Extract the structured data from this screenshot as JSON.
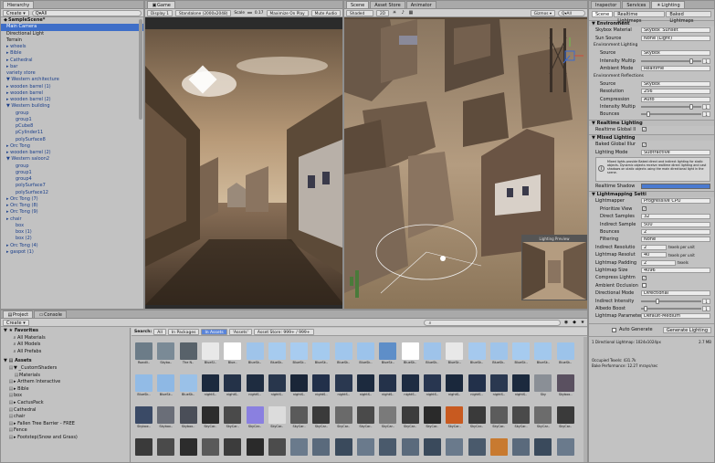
{
  "hierarchy": {
    "tab": "Hierarchy",
    "create": "Create ▾",
    "search": "Q▾All",
    "scene": "SampleScene*",
    "items": [
      {
        "t": "Main Camera",
        "sel": true
      },
      {
        "t": "Directional Light",
        "dk": true
      },
      {
        "t": "Terrain",
        "dk": true
      },
      {
        "t": "▸ wheels"
      },
      {
        "t": "▸ Bible"
      },
      {
        "t": "▸ Cathedral"
      },
      {
        "t": "▸ bar"
      },
      {
        "t": "variety store"
      },
      {
        "t": "▼ Western architecture"
      },
      {
        "t": "▸ wooden barrel (1)"
      },
      {
        "t": "▸ wooden barrel"
      },
      {
        "t": "▸ wooden barrel (2)"
      },
      {
        "t": "▼ Western building"
      },
      {
        "t": "group"
      },
      {
        "t": "group1"
      },
      {
        "t": "pCube8"
      },
      {
        "t": "pCylinder11"
      },
      {
        "t": "polySurface8"
      },
      {
        "t": "▸ Orc Tong"
      },
      {
        "t": "▸ wooden barrel (2)"
      },
      {
        "t": "▼ Western saloon2"
      },
      {
        "t": "group"
      },
      {
        "t": "group1"
      },
      {
        "t": "group4"
      },
      {
        "t": "polySurface7"
      },
      {
        "t": "polySurface12"
      },
      {
        "t": "▸ Orc Tong (7)"
      },
      {
        "t": "▸ Orc Tong (8)"
      },
      {
        "t": "▸ Orc Tong (9)"
      },
      {
        "t": "▸ chair"
      },
      {
        "t": "box"
      },
      {
        "t": "box (1)"
      },
      {
        "t": "box (2)"
      },
      {
        "t": "▸ Orc Tong (4)"
      },
      {
        "t": "▸ gaspot (1)"
      }
    ]
  },
  "game": {
    "tab": "Game",
    "display": "Display 1",
    "resolution": "Standalone (2000x2048)",
    "scale_label": "Scale",
    "scale_value": "0.17",
    "maximize": "Maximize On Play",
    "mute": "Mute Audio"
  },
  "scene": {
    "tabs": [
      "Scene",
      "Asset Store",
      "Animator"
    ],
    "shading": "Shaded",
    "mode2d": "2D",
    "gizmos": "Gizmos ▾",
    "search": "Q▾All",
    "preview_label": "Lighting Preview"
  },
  "inspector": {
    "tabs": [
      "Inspector",
      "Services",
      "Lighting"
    ],
    "subtabs": [
      "Scene",
      "Realtime Lightmaps",
      "Baked Lightmaps"
    ],
    "environment": {
      "header": "Environment",
      "skybox_label": "Skybox Material",
      "skybox_value": "Skybox_Sunset",
      "sun_label": "Sun Source",
      "sun_value": "None (Light)",
      "lighting_header": "Environment Lighting",
      "source_label": "Source",
      "source_value": "Skybox",
      "intensity_label": "Intensity Multip",
      "intensity_value": "1",
      "intensity_level": 0.85,
      "ambient_label": "Ambient Mode",
      "ambient_value": "Realtime",
      "reflections_header": "Environment Reflections",
      "refl_source_label": "Source",
      "refl_source_value": "Skybox",
      "resolution_label": "Resolution",
      "resolution_value": "256",
      "compression_label": "Compression",
      "compression_value": "Auto",
      "refl_intensity_label": "Intensity Multip",
      "refl_intensity_value": "1",
      "refl_intensity_level": 0.85,
      "bounces_label": "Bounces",
      "bounces_value": "1",
      "bounces_level": 0.1
    },
    "realtime": {
      "header": "Realtime Lighting",
      "gi_label": "Realtime Global Il"
    },
    "mixed": {
      "header": "Mixed Lighting",
      "baked_label": "Baked Global Illur",
      "mode_label": "Lighting Mode",
      "mode_value": "Subtractive",
      "info": "Mixed lights provide Baked direct and indirect lighting for static objects. Dynamic objects receive realtime direct lighting and cast shadows on static objects using the main directional light in the scene.",
      "shadow_label": "Realtime Shadow"
    },
    "lightmapping": {
      "header": "Lightmapping Setti",
      "lightmapper_label": "Lightmapper",
      "lightmapper_value": "Progressive CPU",
      "prioritize_label": "Prioritize View",
      "direct_label": "Direct Samples",
      "direct_value": "32",
      "indirect_label": "Indirect Sample",
      "indirect_value": "500",
      "bounces_label": "Bounces",
      "bounces_value": "2",
      "filtering_label": "Filtering",
      "filtering_value": "None",
      "indirect_res_label": "Indirect Resolutio",
      "indirect_res_value": "2",
      "lightmap_res_label": "Lightmap Resolut",
      "lightmap_res_value": "40",
      "padding_label": "Lightmap Padding",
      "padding_value": "2",
      "size_label": "Lightmap Size",
      "size_value": "4096",
      "compress_label": "Compress Lightm",
      "ao_label": "Ambient Occlusion",
      "dir_mode_label": "Directional Mode",
      "dir_mode_value": "Directional",
      "indirect_int_label": "Indirect Intensity",
      "indirect_int_value": "1",
      "indirect_int_level": 0.25,
      "albedo_label": "Albedo Boost",
      "albedo_value": "1",
      "albedo_level": 0.05,
      "params_label": "Lightmap Parameter",
      "params_value": "Default-Medium",
      "unit_texels": "texels per unit",
      "unit_texels2": "texels"
    },
    "auto_generate": "Auto Generate",
    "generate_button": "Generate Lighting",
    "stats_line1": "1 Directional Lightmap: 1024x1024px",
    "stats_size": "2.7 MB",
    "stats_line2": "Occupied Texels: 431.7k",
    "stats_line3": "Bake Performance: 12.27 mrays/sec"
  },
  "project": {
    "tabs": [
      "Project",
      "Console"
    ],
    "create": "Create ▾",
    "search_label": "Search:",
    "search_scopes": [
      "All",
      "In Packages",
      "In Assets",
      "'Assets'",
      "Asset Store: 999+ / 999+"
    ],
    "favorites_header": "Favorites",
    "favorites": [
      "All Materials",
      "All Models",
      "All Prefabs"
    ],
    "assets_header": "Assets",
    "folders": [
      {
        "t": "▼ _CustomShaders",
        "d": 1
      },
      {
        "t": "Materials",
        "d": 2
      },
      {
        "t": "▸ Arthem Interactive",
        "d": 1
      },
      {
        "t": "▸ Bible",
        "d": 1
      },
      {
        "t": "box",
        "d": 1
      },
      {
        "t": "▸ CactusPack",
        "d": 1
      },
      {
        "t": "Cathedral",
        "d": 1
      },
      {
        "t": "chair",
        "d": 1
      },
      {
        "t": "▸ Fallen Tree Barrier - FREE",
        "d": 1
      },
      {
        "t": "Fence",
        "d": 1
      },
      {
        "t": "▸ Footstep(Snow and Grass)",
        "d": 1
      }
    ],
    "asset_rows": [
      {
        "names": [
          "Roadli..",
          "Skybo..",
          "The N..",
          "BlueSl..",
          "Blue..",
          "BlueSk..",
          "BlueSk..",
          "BlueSk..",
          "BlueSk..",
          "BlueSk..",
          "BlueSk..",
          "BlueSk..",
          "BlueSk..",
          "BlueSk..",
          "BlueSk..",
          "BlueSk..",
          "BlueSk..",
          "BlueSk..",
          "BlueSk..",
          "BlueSk.."
        ],
        "colors": [
          "#6c7c88",
          "#7a8a96",
          "#58626a",
          "#e8e8e8",
          "#ffffff",
          "#9fc4ea",
          "#a6cbef",
          "#a8ccf0",
          "#a4caee",
          "#a0c6ec",
          "#9cc3eb",
          "#5e8ec8",
          "#ffffff",
          "#9ec3ea",
          "#e8e8e8",
          "#a5c9ee",
          "#9fc4ea",
          "#a6cbef",
          "#a2c8ed",
          "#9cc3ea"
        ]
      },
      {
        "names": [
          "BlueSk..",
          "BlueSk..",
          "BlueSk..",
          "nightS..",
          "nightS..",
          "nightS..",
          "nightS..",
          "nightS..",
          "nightS..",
          "nightS..",
          "nightS..",
          "nightS..",
          "nightS..",
          "nightS..",
          "nightS..",
          "nightS..",
          "nightS..",
          "nightS..",
          "Sky",
          "Skybox.."
        ],
        "colors": [
          "#92bbe6",
          "#8eb8e4",
          "#9ac1e8",
          "#1c2a3e",
          "#243248",
          "#1e2c40",
          "#28364c",
          "#1a2638",
          "#22304a",
          "#2a3850",
          "#1c2a3e",
          "#24324a",
          "#1e2c42",
          "#283650",
          "#1a283c",
          "#22304a",
          "#2a3850",
          "#1c2a3e",
          "#8a8f96",
          "#5a5060"
        ]
      },
      {
        "names": [
          "Skybox..",
          "Skybox..",
          "Skybox..",
          "SkyCar..",
          "SkyCar..",
          "SkyCar..",
          "SkyCar..",
          "SkyCar..",
          "SkyCar..",
          "SkyCar..",
          "SkyCar..",
          "SkyCar..",
          "SkyCar..",
          "SkyCar..",
          "SkyCar..",
          "SkyCar..",
          "SkyCar..",
          "SkyCar..",
          "SkyCar..",
          "SkyCar.."
        ],
        "colors": [
          "#3a4a66",
          "#6a6e78",
          "#4a4e58",
          "#2c2c2c",
          "#4a4a4a",
          "#8a80e0",
          "#dcdcdc",
          "#5a5a5a",
          "#3a3a3a",
          "#6a6a6a",
          "#4a4a4a",
          "#7a7a7a",
          "#3c3c3c",
          "#2a2a2a",
          "#c85a20",
          "#3a3a3a",
          "#5c5c5c",
          "#4a4a4a",
          "#6c6c6c",
          "#3a3a3a"
        ]
      },
      {
        "names": [
          "",
          "",
          "",
          "",
          "",
          "",
          "",
          "",
          "",
          "",
          "",
          "",
          "",
          "",
          "",
          "",
          "",
          "",
          "",
          ""
        ],
        "colors": [
          "#3a3a3a",
          "#4a4a4a",
          "#2c2c2c",
          "#5a5a5a",
          "#3c3c3c",
          "#2a2a2a",
          "#4c4c4c",
          "#6a7a8c",
          "#5a6a7c",
          "#3a4a5c",
          "#6a7a8c",
          "#4a5a6c",
          "#5a6a7c",
          "#3a4a5c",
          "#6a7a8c",
          "#4a5a6c",
          "#c87a30",
          "#5a6a7c",
          "#3a4a5c",
          "#6a7a8c"
        ]
      }
    ]
  }
}
